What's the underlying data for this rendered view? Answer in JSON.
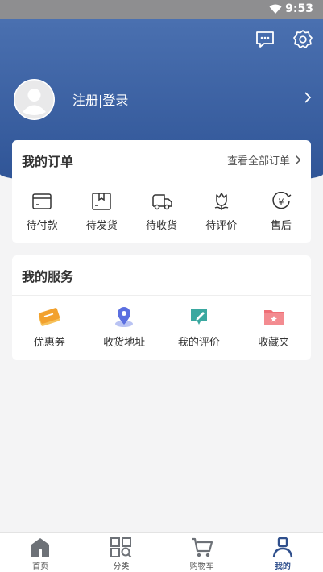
{
  "status": {
    "time": "9:53"
  },
  "profile": {
    "login_label": "注册|登录"
  },
  "orders": {
    "title": "我的订单",
    "view_all": "查看全部订单",
    "items": [
      {
        "label": "待付款",
        "icon": "wallet-icon"
      },
      {
        "label": "待发货",
        "icon": "package-icon"
      },
      {
        "label": "待收货",
        "icon": "truck-icon"
      },
      {
        "label": "待评价",
        "icon": "flower-icon"
      },
      {
        "label": "售后",
        "icon": "yen-refund-icon"
      }
    ]
  },
  "services": {
    "title": "我的服务",
    "items": [
      {
        "label": "优惠券",
        "icon": "coupon-icon",
        "color": "#f2a12e"
      },
      {
        "label": "收货地址",
        "icon": "location-pin-icon",
        "color": "#5b6fe0"
      },
      {
        "label": "我的评价",
        "icon": "review-pen-icon",
        "color": "#3aa8a0"
      },
      {
        "label": "收藏夹",
        "icon": "favorites-folder-icon",
        "color": "#ef6f76"
      }
    ]
  },
  "tabs": [
    {
      "label": "首页",
      "icon": "home-icon"
    },
    {
      "label": "分类",
      "icon": "category-grid-icon"
    },
    {
      "label": "购物车",
      "icon": "cart-icon"
    },
    {
      "label": "我的",
      "icon": "user-icon",
      "active": true
    }
  ],
  "colors": {
    "primary": "#2f5496",
    "header_top": "#4a70b0",
    "active_tab": "#2f4f8c"
  }
}
